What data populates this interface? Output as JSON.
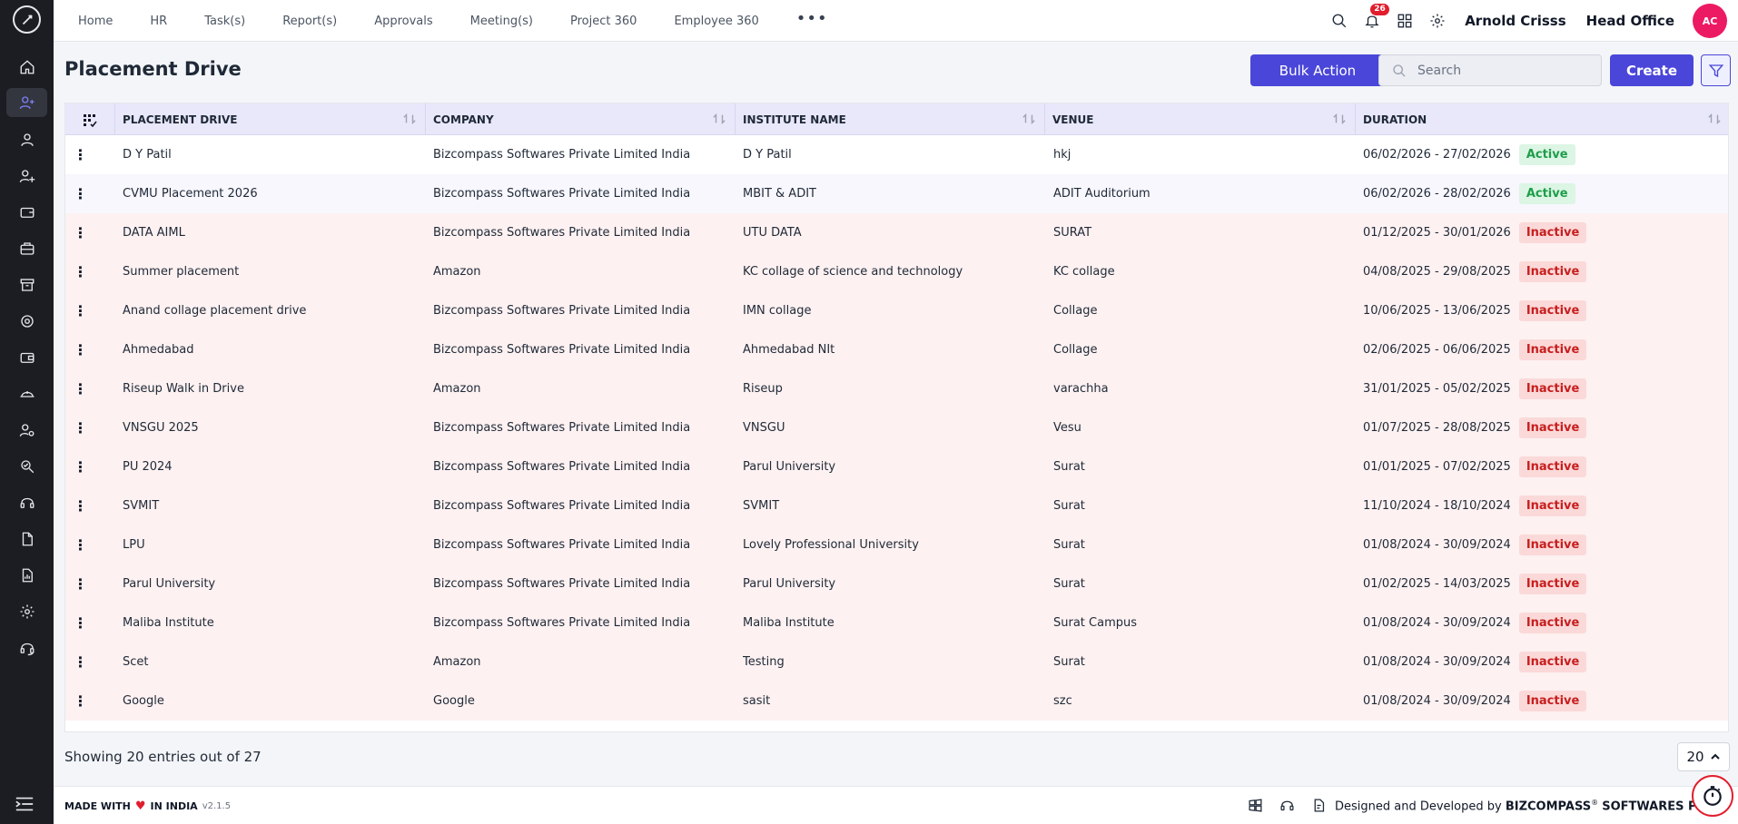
{
  "nav": {
    "items": [
      "Home",
      "HR",
      "Task(s)",
      "Report(s)",
      "Approvals",
      "Meeting(s)",
      "Project 360",
      "Employee 360"
    ],
    "more": "•••"
  },
  "header": {
    "notifications_count": "26",
    "user_name": "Arnold Crisss",
    "branch": "Head Office",
    "avatar_initials": "AC"
  },
  "page": {
    "title": "Placement Drive",
    "bulk_action_label": "Bulk Action",
    "search_placeholder": "Search",
    "create_label": "Create"
  },
  "table": {
    "columns": [
      "PLACEMENT DRIVE",
      "COMPANY",
      "INSTITUTE NAME",
      "VENUE",
      "DURATION"
    ],
    "rows": [
      {
        "drive": "D Y Patil",
        "company": "Bizcompass Softwares Private Limited India",
        "institute": "D Y Patil",
        "venue": "hkj",
        "duration": "06/02/2026 - 27/02/2026",
        "status": "Active"
      },
      {
        "drive": "CVMU Placement 2026",
        "company": "Bizcompass Softwares Private Limited India",
        "institute": "MBIT & ADIT",
        "venue": "ADIT Auditorium",
        "duration": "06/02/2026 - 28/02/2026",
        "status": "Active"
      },
      {
        "drive": "DATA AIML",
        "company": "Bizcompass Softwares Private Limited India",
        "institute": "UTU DATA",
        "venue": "SURAT",
        "duration": "01/12/2025 - 30/01/2026",
        "status": "Inactive"
      },
      {
        "drive": "Summer placement",
        "company": "Amazon",
        "institute": "KC collage of science and technology",
        "venue": "KC collage",
        "duration": "04/08/2025 - 29/08/2025",
        "status": "Inactive"
      },
      {
        "drive": "Anand collage placement drive",
        "company": "Bizcompass Softwares Private Limited India",
        "institute": "IMN collage",
        "venue": "Collage",
        "duration": "10/06/2025 - 13/06/2025",
        "status": "Inactive"
      },
      {
        "drive": "Ahmedabad",
        "company": "Bizcompass Softwares Private Limited India",
        "institute": "Ahmedabad NIt",
        "venue": "Collage",
        "duration": "02/06/2025 - 06/06/2025",
        "status": "Inactive"
      },
      {
        "drive": "Riseup Walk in Drive",
        "company": "Amazon",
        "institute": "Riseup",
        "venue": "varachha",
        "duration": "31/01/2025 - 05/02/2025",
        "status": "Inactive"
      },
      {
        "drive": "VNSGU 2025",
        "company": "Bizcompass Softwares Private Limited India",
        "institute": "VNSGU",
        "venue": "Vesu",
        "duration": "01/07/2025 - 28/08/2025",
        "status": "Inactive"
      },
      {
        "drive": "PU 2024",
        "company": "Bizcompass Softwares Private Limited India",
        "institute": "Parul University",
        "venue": "Surat",
        "duration": "01/01/2025 - 07/02/2025",
        "status": "Inactive"
      },
      {
        "drive": "SVMIT",
        "company": "Bizcompass Softwares Private Limited India",
        "institute": "SVMIT",
        "venue": "Surat",
        "duration": "11/10/2024 - 18/10/2024",
        "status": "Inactive"
      },
      {
        "drive": "LPU",
        "company": "Bizcompass Softwares Private Limited India",
        "institute": "Lovely Professional University",
        "venue": "Surat",
        "duration": "01/08/2024 - 30/09/2024",
        "status": "Inactive"
      },
      {
        "drive": "Parul University",
        "company": "Bizcompass Softwares Private Limited India",
        "institute": "Parul University",
        "venue": "Surat",
        "duration": "01/02/2025 - 14/03/2025",
        "status": "Inactive"
      },
      {
        "drive": "Maliba Institute",
        "company": "Bizcompass Softwares Private Limited India",
        "institute": "Maliba Institute",
        "venue": "Surat Campus",
        "duration": "01/08/2024 - 30/09/2024",
        "status": "Inactive"
      },
      {
        "drive": "Scet",
        "company": "Amazon",
        "institute": "Testing",
        "venue": "Surat",
        "duration": "01/08/2024 - 30/09/2024",
        "status": "Inactive"
      },
      {
        "drive": "Google",
        "company": "Google",
        "institute": "sasit",
        "venue": "szc",
        "duration": "01/08/2024 - 30/09/2024",
        "status": "Inactive"
      }
    ]
  },
  "pagination": {
    "showing_text": "Showing 20 entries out of 27",
    "page_size": "20"
  },
  "footer": {
    "made_with": "MADE WITH",
    "in_india": "IN INDIA",
    "version": "v2.1.5",
    "designed_by": "Designed and Developed by",
    "company": "BIZCOMPASS",
    "registered": "®",
    "company_suffix": "SOFTWARES PV"
  },
  "colors": {
    "accent": "#4a46d9",
    "sidebar_bg": "#1c1d22",
    "active_status": "#1e9e4a",
    "inactive_status": "#c81e1e",
    "avatar_bg": "#ec1a63"
  },
  "icons": {
    "sidebar": [
      "home-icon",
      "user-plus-icon",
      "user-icon",
      "user-add-icon",
      "wallet-icon",
      "briefcase-icon",
      "archive-icon",
      "support-icon",
      "wallet-alt-icon",
      "helmet-icon",
      "user-gear-icon",
      "search-check-icon",
      "headset-icon",
      "document-icon",
      "document-chart-icon",
      "gear-icon",
      "headset-alt-icon"
    ],
    "topbar": [
      "search-icon",
      "bell-icon",
      "grid-icon",
      "gear-icon"
    ]
  }
}
